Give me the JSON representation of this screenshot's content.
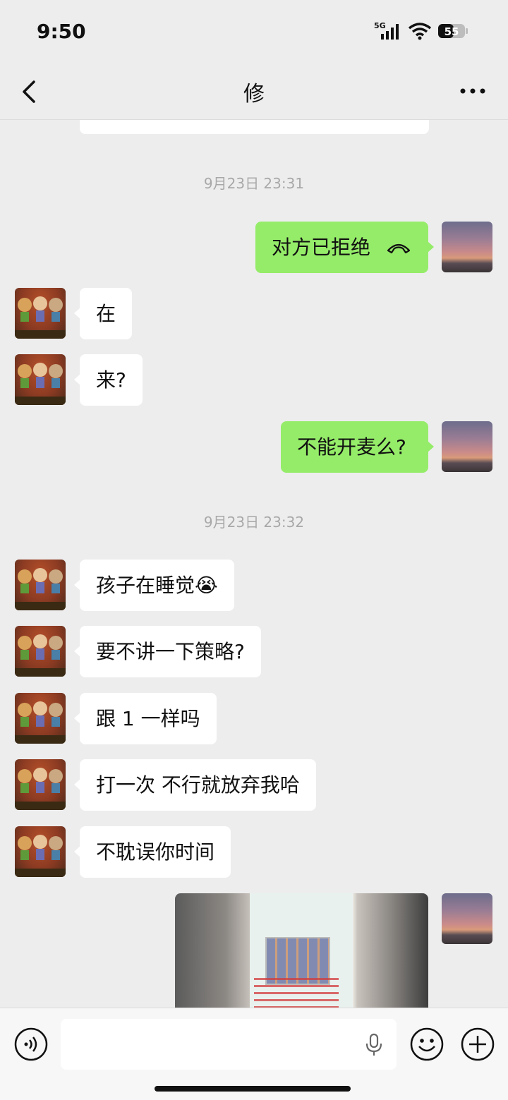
{
  "status_bar": {
    "time": "9:50",
    "network": "5G",
    "battery": "55"
  },
  "nav": {
    "title": "修",
    "back_icon": "chevron-left-icon",
    "more_icon": "more-horizontal-icon"
  },
  "messages": {
    "time1": "9月23日 23:31",
    "call_rejected": "对方已拒绝",
    "msg_zai": "在",
    "msg_lai": "来?",
    "msg_mic": "不能开麦么?",
    "time2": "9月23日 23:32",
    "msg_child": "孩子在睡觉",
    "msg_child_emoji": "😭",
    "msg_strategy": "要不讲一下策略?",
    "msg_same": "跟 1 一样吗",
    "msg_try": "打一次 不行就放弃我哈",
    "msg_time": "不耽误你时间"
  },
  "bottom_bar": {
    "voice_icon": "voice-icon",
    "mic_icon": "mic-icon",
    "emoji_icon": "emoji-icon",
    "plus_icon": "plus-icon"
  },
  "colors": {
    "background": "#ededed",
    "bubble_sent": "#95ec69",
    "bubble_received": "#ffffff",
    "timestamp": "#a8a8a8"
  }
}
